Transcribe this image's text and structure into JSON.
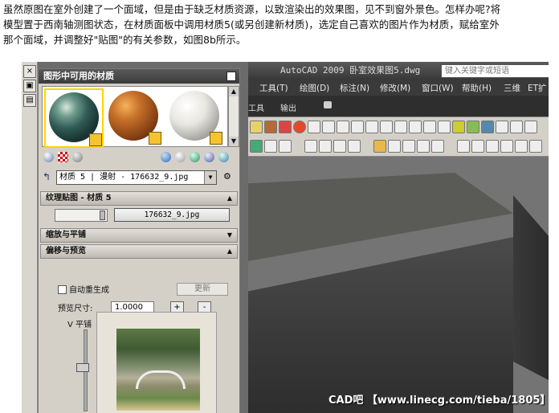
{
  "article": {
    "line1": "虽然原图在室外创建了一个面域，但是由于缺乏材质资源，以致渲染出的效果图，见不到窗外景色。怎样办呢?将",
    "line2": "模型置于西南轴测图状态，在材质面板中调用材质5(或另创建新材质)，选定自己喜欢的图片作为材质，赋给室外",
    "line3": "那个面域，并调整好\"贴图\"的有关参数，如图8b所示。"
  },
  "materials_panel": {
    "title": "图形中可用的材质",
    "material_selector": "材质 5 | 漫射 - 176632_9.jpg",
    "texture_section": "纹理贴图 - 材质 5",
    "texture_file": "176632_9.jpg",
    "scale_section": "缩放与平铺",
    "offset_section": "偏移与预览",
    "auto_regen_label": "自动重生成",
    "update_button": "更新",
    "preview_size_label": "预览尺寸:",
    "preview_size_value": "1.0000",
    "plus": "+",
    "minus": "-",
    "v_tile_label": "V 平铺"
  },
  "acad": {
    "title": "AutoCAD 2009  卧室效果图5.dwg",
    "search_placeholder": "键入关键字或短语",
    "menus": [
      "工具(T)",
      "绘图(D)",
      "标注(N)",
      "修改(M)",
      "窗口(W)",
      "帮助(H)",
      "三维",
      "ET扩"
    ],
    "sub_labels": [
      "工具",
      "输出"
    ]
  },
  "watermark": "CAD吧 【www.linecg.com/tieba/1805】",
  "colors": {
    "selection": "#ffd400",
    "title_dark": "#3b3b3b",
    "panel_bg": "#d4d0c8"
  }
}
